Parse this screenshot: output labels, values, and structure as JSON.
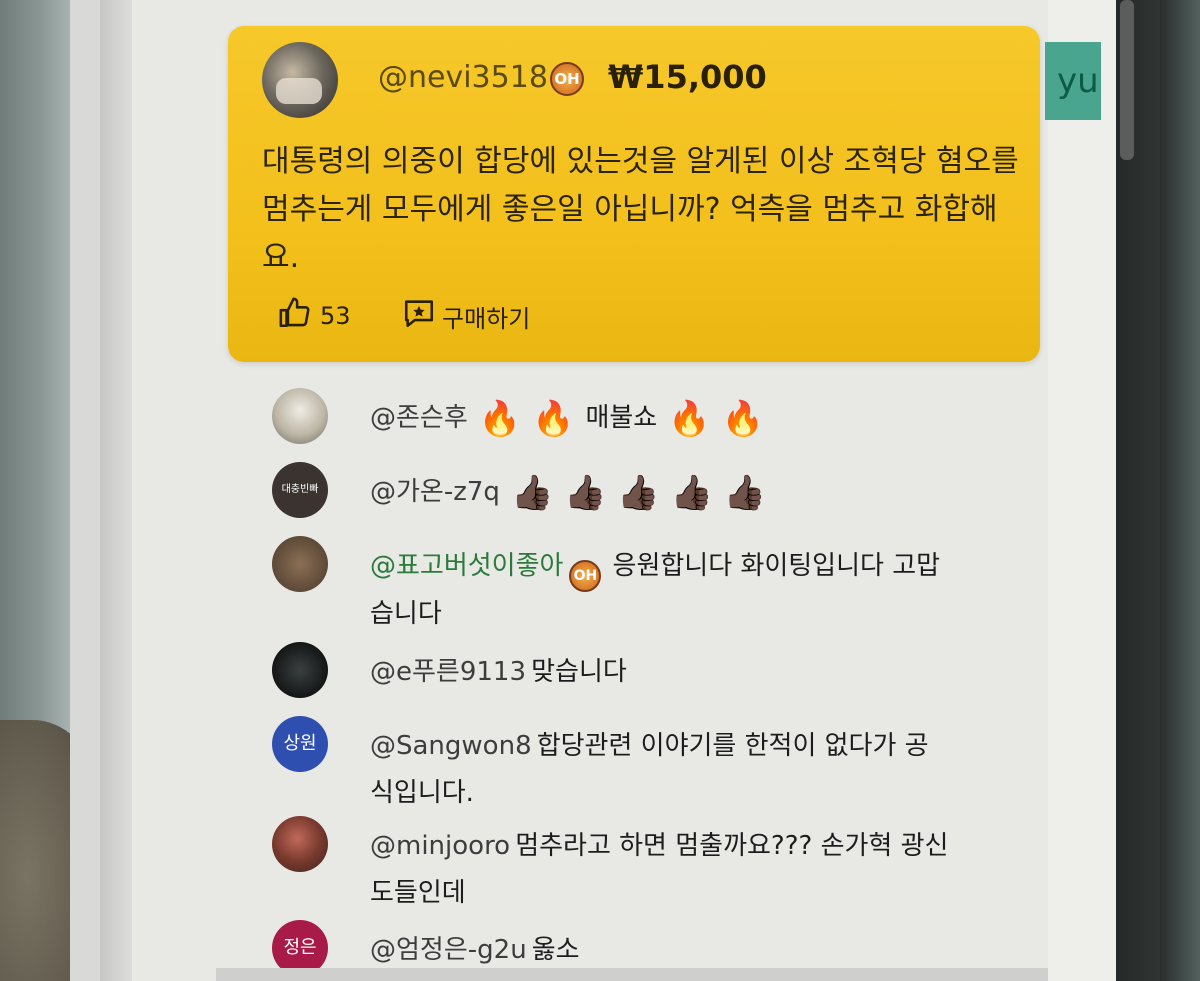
{
  "superchat": {
    "author": "@nevi3518",
    "badge_text": "OH",
    "amount": "₩15,000",
    "message": "대통령의 의중이 합당에 있는것을 알게된 이상 조혁당 혐오를 멈추는게 모두에게 좋은일 아닙니까? 억측을 멈추고 화합해요.",
    "like_count": "53",
    "buy_label": "구매하기"
  },
  "side_label": "yu",
  "messages": [
    {
      "author": "@존슨후",
      "text": "매불쇼",
      "emojis_before": "🔥 🔥",
      "emojis_after": "🔥 🔥"
    },
    {
      "author": "@가온-z7q",
      "text": "",
      "emojis": "👍🏿 👍🏿 👍🏿 👍🏿 👍🏿",
      "avatar_text": "대충빈빠"
    },
    {
      "author": "@표고버섯이좋아",
      "badge_text": "OH",
      "text": "응원합니다 화이팅입니다 고맙",
      "text2": "습니다"
    },
    {
      "author": "@e푸른9113",
      "text": "맞습니다"
    },
    {
      "author": "@Sangwon8",
      "avatar_text": "상원",
      "text": "합당관련 이야기를 한적이 없다가 공",
      "text2": "식입니다."
    },
    {
      "author": "@minjooro",
      "text": "멈추라고 하면 멈출까요??? 손가혁 광신",
      "text2": "도들인데"
    },
    {
      "author": "@엄정은-g2u",
      "avatar_text": "정은",
      "text": "옳소"
    }
  ],
  "colors": {
    "superchat_bg": "#f3c01c",
    "member_name": "#2b7a3a",
    "avatar_sangwon": "#2f4fb0",
    "avatar_jeongeun": "#a81a48"
  },
  "icons": {
    "like": "thumbs-up-icon",
    "buy": "star-chat-icon"
  }
}
